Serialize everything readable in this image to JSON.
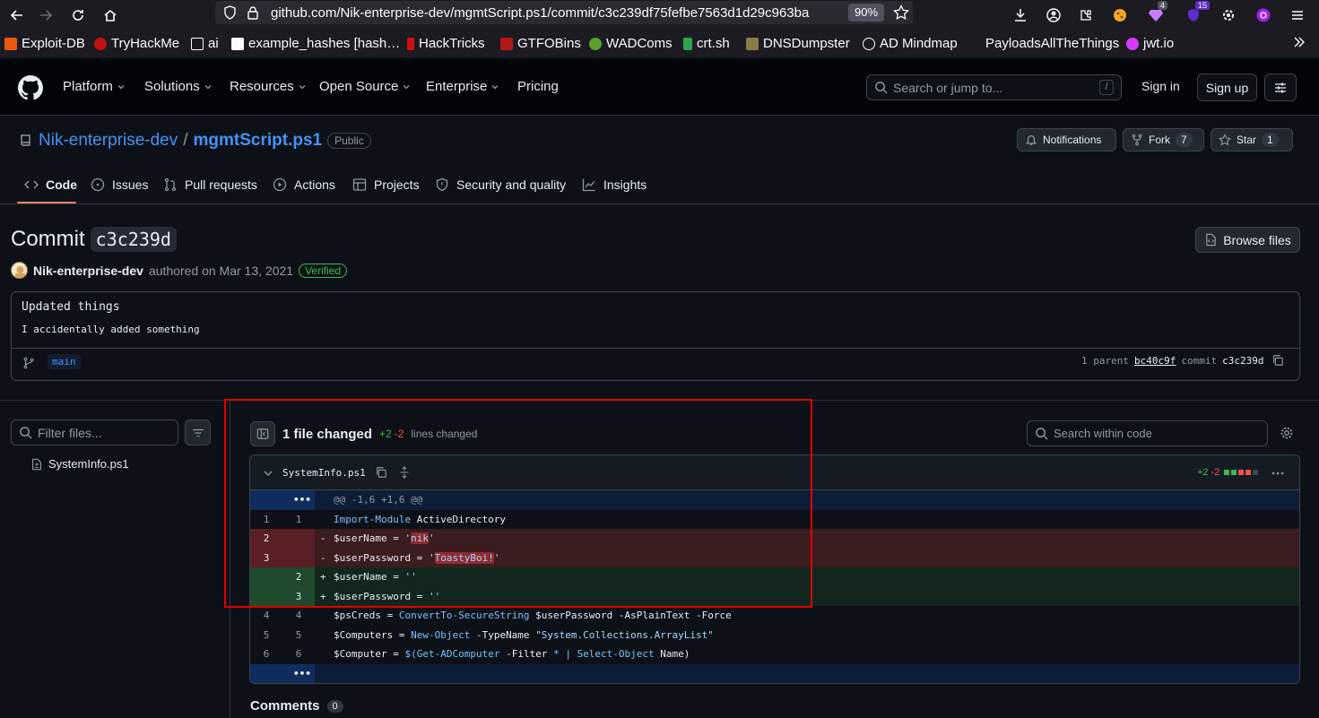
{
  "browser": {
    "url": "github.com/Nik-enterprise-dev/mgmtScript.ps1/commit/c3c239df75fefbe7563d1d29c963ba",
    "zoom": "90%",
    "ext_badge_1": "4",
    "ext_badge_2": "15",
    "bookmarks": [
      "Exploit-DB",
      "TryHackMe",
      "ai",
      "example_hashes [hash…",
      "HackTricks",
      "GTFOBins",
      "WADComs",
      "crt.sh",
      "DNSDumpster",
      "AD Mindmap",
      "PayloadsAllTheThings",
      "jwt.io"
    ]
  },
  "header": {
    "nav": [
      "Platform",
      "Solutions",
      "Resources",
      "Open Source",
      "Enterprise",
      "Pricing"
    ],
    "search_placeholder": "Search or jump to...",
    "slash": "/",
    "sign_in": "Sign in",
    "sign_up": "Sign up"
  },
  "repo": {
    "owner": "Nik-enterprise-dev",
    "sep": "/",
    "name": "mgmtScript.ps1",
    "visibility": "Public",
    "notifications": "Notifications",
    "fork": "Fork",
    "fork_count": "7",
    "star": "Star",
    "star_count": "1",
    "tabs": [
      "Code",
      "Issues",
      "Pull requests",
      "Actions",
      "Projects",
      "Security and quality",
      "Insights"
    ]
  },
  "commit": {
    "label": "Commit",
    "sha": "c3c239d",
    "browse": "Browse files",
    "author": "Nik-enterprise-dev",
    "authored": "authored on Mar 13, 2021",
    "verified": "Verified",
    "title": "Updated things",
    "body": "I accidentally added something",
    "branch": "main",
    "parent_text": "1 parent",
    "parent_sha": "bc40c9f",
    "commit_text": "commit",
    "commit_sha": "c3c239d"
  },
  "sidebar": {
    "filter_placeholder": "Filter files...",
    "file": "SystemInfo.ps1"
  },
  "diff": {
    "files_changed": "1 file changed",
    "additions": "+2",
    "deletions": "-2",
    "lines_changed": "lines changed",
    "search_placeholder": "Search within code",
    "filename": "SystemInfo.ps1",
    "file_add": "+2",
    "file_del": "-2",
    "hunk": "@@ -1,6 +1,6 @@",
    "rows": [
      {
        "type": "ctx",
        "l1": "1",
        "l2": "1",
        "sign": " ",
        "code": "Import-Module ActiveDirectory"
      },
      {
        "type": "del",
        "l1": "2",
        "l2": "",
        "sign": "-",
        "code": "$userName = 'nik'"
      },
      {
        "type": "del",
        "l1": "3",
        "l2": "",
        "sign": "-",
        "code": "$userPassword = 'ToastyBoi!'"
      },
      {
        "type": "add",
        "l1": "",
        "l2": "2",
        "sign": "+",
        "code": "$userName = ''"
      },
      {
        "type": "add",
        "l1": "",
        "l2": "3",
        "sign": "+",
        "code": "$userPassword = ''"
      },
      {
        "type": "ctx",
        "l1": "4",
        "l2": "4",
        "sign": " ",
        "code": "$psCreds = ConvertTo-SecureString $userPassword -AsPlainText -Force"
      },
      {
        "type": "ctx",
        "l1": "5",
        "l2": "5",
        "sign": " ",
        "code": "$Computers = New-Object -TypeName \"System.Collections.ArrayList\""
      },
      {
        "type": "ctx",
        "l1": "6",
        "l2": "6",
        "sign": " ",
        "code": "$Computer = $(Get-ADComputer -Filter * | Select-Object Name)"
      }
    ],
    "expand": "•••"
  },
  "comments": {
    "label": "Comments",
    "count": "0"
  },
  "colors": {
    "accent": "#4493f8",
    "add": "#3fb950",
    "del": "#f85149",
    "annotation": "#e00000"
  }
}
